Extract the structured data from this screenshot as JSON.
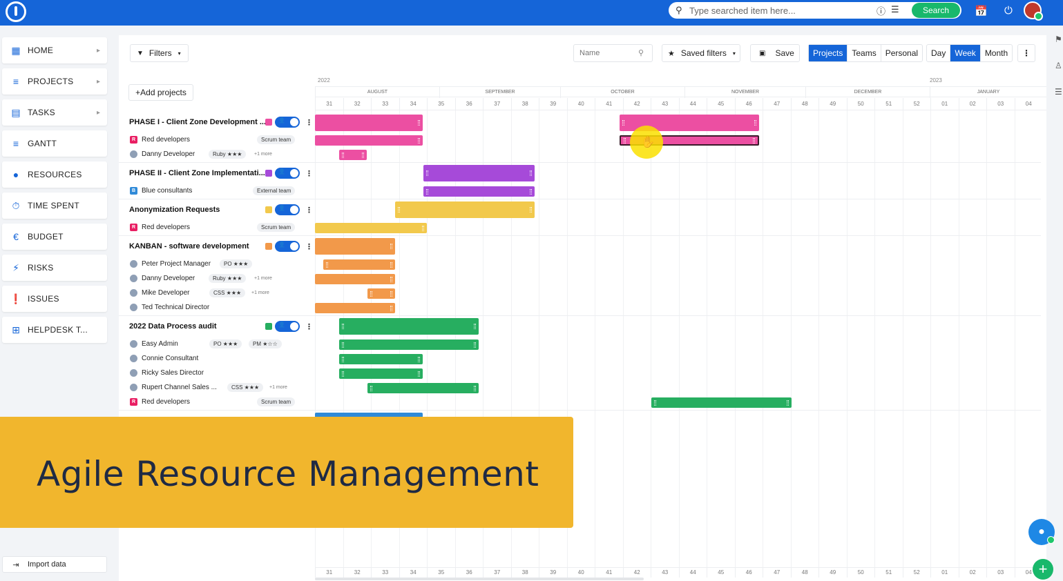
{
  "search": {
    "placeholder": "Type searched item here...",
    "button": "Search"
  },
  "sidebar": {
    "items": [
      {
        "label": "HOME",
        "icon": "dashboard-icon"
      },
      {
        "label": "PROJECTS",
        "icon": "tree-icon"
      },
      {
        "label": "TASKS",
        "icon": "clipboard-icon"
      },
      {
        "label": "GANTT",
        "icon": "gantt-icon"
      },
      {
        "label": "RESOURCES",
        "icon": "person-icon"
      },
      {
        "label": "TIME SPENT",
        "icon": "stopwatch-icon"
      },
      {
        "label": "BUDGET",
        "icon": "euro-icon"
      },
      {
        "label": "RISKS",
        "icon": "bolt-icon"
      },
      {
        "label": "ISSUES",
        "icon": "alert-icon"
      },
      {
        "label": "HELPDESK T...",
        "icon": "plus-square-icon"
      }
    ],
    "import": "Import data"
  },
  "toolbar": {
    "filters": "Filters",
    "name_placeholder": "Name",
    "saved_filters": "Saved filters",
    "save": "Save",
    "views": [
      "Projects",
      "Teams",
      "Personal"
    ],
    "active_view": "Projects",
    "scales": [
      "Day",
      "Week",
      "Month"
    ],
    "active_scale": "Week"
  },
  "add_projects": "Add projects",
  "timeline": {
    "years": [
      "2022",
      "2023"
    ],
    "months": [
      "AUGUST",
      "SEPTEMBER",
      "OCTOBER",
      "NOVEMBER",
      "DECEMBER",
      "JANUARY"
    ],
    "weeks": [
      "31",
      "32",
      "33",
      "34",
      "35",
      "36",
      "37",
      "38",
      "39",
      "40",
      "41",
      "42",
      "43",
      "44",
      "45",
      "46",
      "47",
      "48",
      "49",
      "50",
      "51",
      "52",
      "01",
      "02",
      "03",
      "04"
    ]
  },
  "projects": [
    {
      "title": "PHASE I - Client Zone Development ...",
      "color": "#ec4fa2",
      "members": [
        {
          "name": "Red developers",
          "type": "team",
          "badge": "R",
          "badge_color": "#e91e63",
          "tag": "Scrum team"
        },
        {
          "name": "Danny Developer",
          "type": "person",
          "tag": "Ruby ★★★",
          "more": "+1 more"
        }
      ]
    },
    {
      "title": "PHASE II - Client Zone Implementati...",
      "color": "#a64ad9",
      "members": [
        {
          "name": "Blue consultants",
          "type": "team",
          "badge": "B",
          "badge_color": "#2f8ad8",
          "tag": "External team"
        }
      ]
    },
    {
      "title": "Anonymization Requests",
      "color": "#f2c94c",
      "members": [
        {
          "name": "Red developers",
          "type": "team",
          "badge": "R",
          "badge_color": "#e91e63",
          "tag": "Scrum team"
        }
      ]
    },
    {
      "title": "KANBAN - software development",
      "color": "#f2994a",
      "members": [
        {
          "name": "Peter Project Manager",
          "type": "person",
          "tag": "PO ★★★"
        },
        {
          "name": "Danny Developer",
          "type": "person",
          "tag": "Ruby ★★★",
          "more": "+1 more"
        },
        {
          "name": "Mike Developer",
          "type": "person",
          "tag": "CSS ★★★",
          "more": "+1 more"
        },
        {
          "name": "Ted Technical Director",
          "type": "person"
        }
      ]
    },
    {
      "title": "2022 Data Process audit",
      "color": "#27ae60",
      "members": [
        {
          "name": "Easy Admin",
          "type": "person",
          "tag": "PO ★★★",
          "tag2": "PM ★☆☆"
        },
        {
          "name": "Connie Consultant",
          "type": "person"
        },
        {
          "name": "Ricky Sales Director",
          "type": "person"
        },
        {
          "name": "Rupert Channel Sales ...",
          "type": "person",
          "tag": "CSS ★★★",
          "more": "+1 more"
        },
        {
          "name": "Red developers",
          "type": "team",
          "badge": "R",
          "badge_color": "#e91e63",
          "tag": "Scrum team"
        }
      ]
    }
  ],
  "banner": {
    "text": "Agile Resource Management",
    "color": "#f1b62d"
  }
}
